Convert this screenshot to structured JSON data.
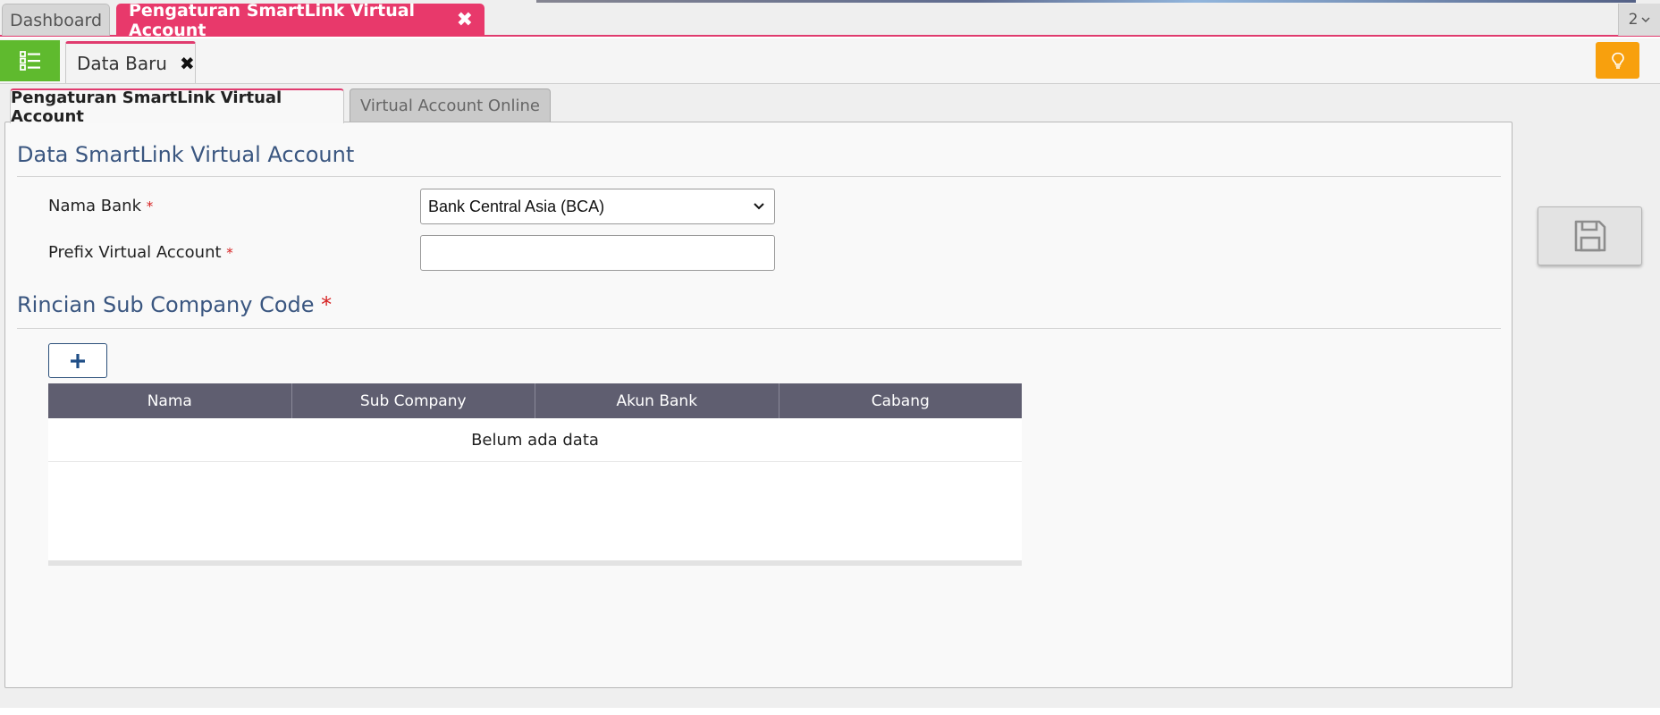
{
  "top_tabs": {
    "dashboard_label": "Dashboard",
    "active_label": "Pengaturan SmartLink Virtual Account",
    "close_glyph": "✖",
    "count": "2"
  },
  "subbar": {
    "menu_icon": "list-icon",
    "doc_tab_label": "Data Baru",
    "doc_tab_close": "✖",
    "bulb_icon": "lightbulb-icon"
  },
  "inner_tabs": [
    {
      "label": "Pengaturan SmartLink Virtual Account",
      "active": true
    },
    {
      "label": "Virtual Account Online",
      "active": false
    }
  ],
  "section1": {
    "title": "Data SmartLink Virtual Account",
    "nama_bank_label": "Nama Bank",
    "nama_bank_value": "Bank Central Asia (BCA)",
    "prefix_label": "Prefix Virtual Account",
    "prefix_value": "",
    "required_mark": "*"
  },
  "section2": {
    "title": "Rincian Sub Company Code",
    "required_mark": "*",
    "add_button": "+",
    "columns": [
      "Nama",
      "Sub Company",
      "Akun Bank",
      "Cabang"
    ],
    "empty_text": "Belum ada data"
  },
  "colors": {
    "accent_pink": "#e8396b",
    "menu_green": "#5fba2e",
    "bulb_orange": "#f8a00d",
    "title_blue": "#3a5680",
    "grid_header": "#5f5e70"
  }
}
